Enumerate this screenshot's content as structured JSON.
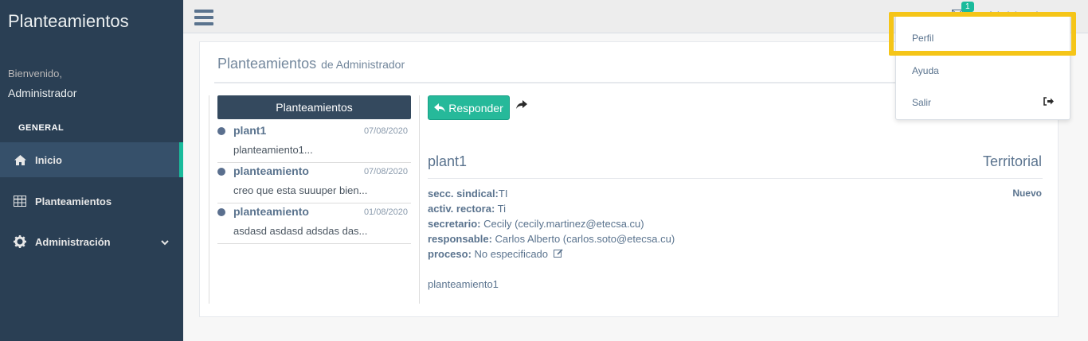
{
  "app": {
    "brand": "Planteamientos",
    "welcome": "Bienvenido,",
    "user": "Administrador"
  },
  "sidebar": {
    "section": "GENERAL",
    "items": [
      {
        "label": "Inicio",
        "icon": "home-icon",
        "active": true
      },
      {
        "label": "Planteamientos",
        "icon": "table-icon",
        "active": false
      },
      {
        "label": "Administración",
        "icon": "gear-icon",
        "active": false
      }
    ]
  },
  "topbar": {
    "notification_count": "1"
  },
  "page": {
    "title": "Planteamientos",
    "subtitle": "de Administrador"
  },
  "list": {
    "header": "Planteamientos",
    "items": [
      {
        "title": "plant1",
        "date": "07/08/2020",
        "snippet": "planteamiento1..."
      },
      {
        "title": "planteamiento",
        "date": "07/08/2020",
        "snippet": "creo que esta suuuper bien..."
      },
      {
        "title": "planteamiento",
        "date": "01/08/2020",
        "snippet": "asdasd asdasd adsdas das..."
      }
    ]
  },
  "detail": {
    "reply_label": "Responder",
    "title": "plant1",
    "type": "Territorial",
    "status": "Nuevo",
    "fields": [
      {
        "label": "secc. sindical:",
        "value": "TI"
      },
      {
        "label": "activ. rectora:",
        "value": " Ti"
      },
      {
        "label": "secretario:",
        "value": " Cecily (cecily.martinez@etecsa.cu)"
      },
      {
        "label": "responsable:",
        "value": " Carlos Alberto (carlos.soto@etecsa.cu)"
      },
      {
        "label": "proceso:",
        "value": " No especificado"
      }
    ],
    "body": "planteamiento1"
  },
  "dropdown": {
    "items": [
      {
        "label": "Perfil"
      },
      {
        "label": "Ayuda"
      },
      {
        "label": "Salir",
        "icon": "sign-out-icon"
      }
    ]
  },
  "colors": {
    "sidebar": "#2a3f54",
    "accent": "#1abb9c",
    "button": "#26b99a",
    "highlight": "#f5c518"
  }
}
